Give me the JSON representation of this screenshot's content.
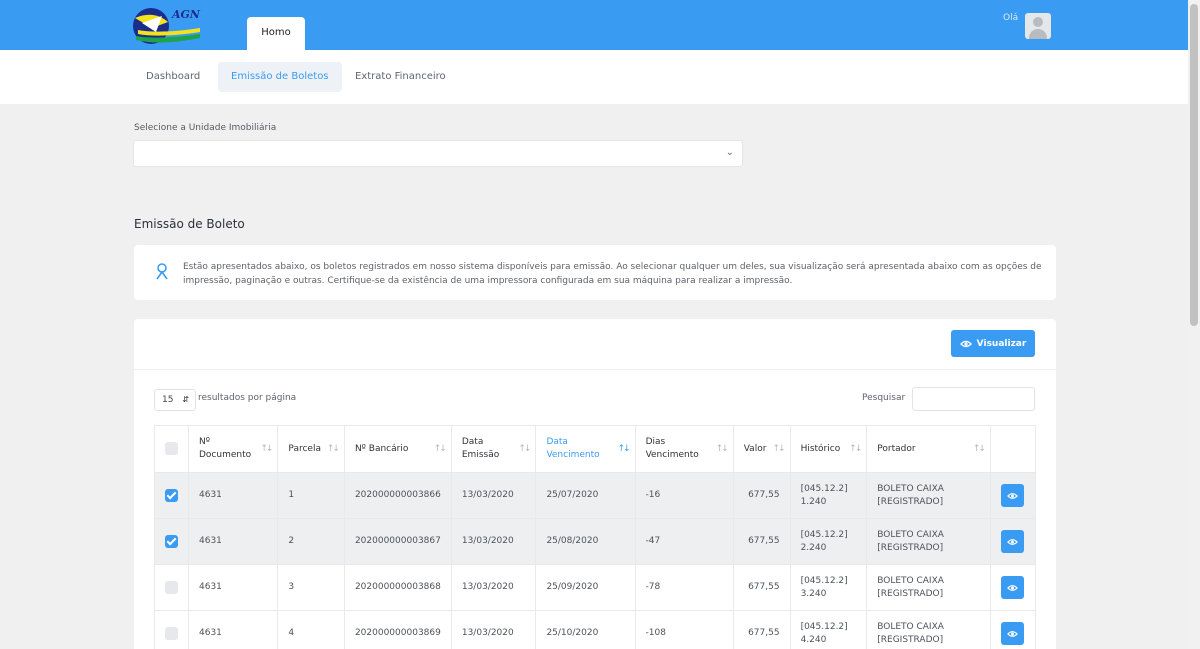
{
  "header": {
    "logo_text": "AGN",
    "home_tab": "Homo",
    "greeting": "Olá"
  },
  "subnav": {
    "items": [
      {
        "label": "Dashboard"
      },
      {
        "label": "Emissão de Boletos"
      },
      {
        "label": "Extrato Financeiro"
      }
    ],
    "active_index": 1
  },
  "unit_select": {
    "label": "Selecione a Unidade Imobiliária",
    "value": ""
  },
  "section": {
    "title": "Emissão de Boleto",
    "info_text": "Estão apresentados abaixo, os boletos registrados em nosso sistema disponíveis para emissão. Ao selecionar qualquer um deles, sua visualização será apresentada abaixo com as opções de impressão, paginação e outras. Certifique-se da existência de uma impressora configurada em sua máquina para realizar a impressão."
  },
  "table_controls": {
    "view_button": "Visualizar",
    "page_size": "15",
    "page_size_label": "resultados por página",
    "search_label": "Pesquisar",
    "search_value": ""
  },
  "table": {
    "columns": [
      {
        "line1": "Nº",
        "line2": "Documento"
      },
      {
        "line1": "Parcela",
        "line2": ""
      },
      {
        "line1": "Nº Bancário",
        "line2": ""
      },
      {
        "line1": "Data",
        "line2": "Emissão"
      },
      {
        "line1": "Data",
        "line2": "Vencimento"
      },
      {
        "line1": "Dias",
        "line2": "Vencimento"
      },
      {
        "line1": "Valor",
        "line2": ""
      },
      {
        "line1": "Histórico",
        "line2": ""
      },
      {
        "line1": "Portador",
        "line2": ""
      }
    ],
    "rows": [
      {
        "checked": true,
        "documento": "4631",
        "parcela": "1",
        "bancario": "202000000003866",
        "emissao": "13/03/2020",
        "vencimento": "25/07/2020",
        "dias": "-16",
        "valor": "677,55",
        "historico_1": "[045.12.2]",
        "historico_2": "1.240",
        "portador_1": "BOLETO CAIXA",
        "portador_2": "[REGISTRADO]"
      },
      {
        "checked": true,
        "documento": "4631",
        "parcela": "2",
        "bancario": "202000000003867",
        "emissao": "13/03/2020",
        "vencimento": "25/08/2020",
        "dias": "-47",
        "valor": "677,55",
        "historico_1": "[045.12.2]",
        "historico_2": "2.240",
        "portador_1": "BOLETO CAIXA",
        "portador_2": "[REGISTRADO]"
      },
      {
        "checked": false,
        "documento": "4631",
        "parcela": "3",
        "bancario": "202000000003868",
        "emissao": "13/03/2020",
        "vencimento": "25/09/2020",
        "dias": "-78",
        "valor": "677,55",
        "historico_1": "[045.12.2]",
        "historico_2": "3.240",
        "portador_1": "BOLETO CAIXA",
        "portador_2": "[REGISTRADO]"
      },
      {
        "checked": false,
        "documento": "4631",
        "parcela": "4",
        "bancario": "202000000003869",
        "emissao": "13/03/2020",
        "vencimento": "25/10/2020",
        "dias": "-108",
        "valor": "677,55",
        "historico_1": "[045.12.2]",
        "historico_2": "4.240",
        "portador_1": "BOLETO CAIXA",
        "portador_2": "[REGISTRADO]"
      }
    ]
  },
  "colors": {
    "primary": "#3a9bf3",
    "background": "#f0f0f1"
  }
}
